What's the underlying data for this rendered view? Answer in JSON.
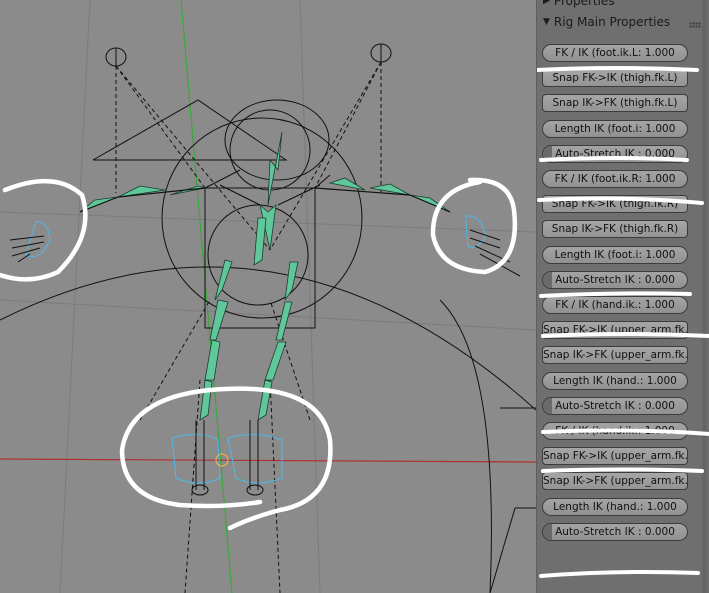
{
  "panel": {
    "properties_header": "Properties",
    "rig_header": "Rig Main Properties",
    "controls": [
      {
        "kind": "slider",
        "label": "FK / IK (foot.ik.L: 1.000",
        "value": 0.0
      },
      {
        "kind": "button",
        "label": "Snap FK->IK (thigh.fk.L)"
      },
      {
        "kind": "button",
        "label": "Snap IK->FK (thigh.fk.L)"
      },
      {
        "kind": "slider",
        "label": "Length IK (foot.i: 1.000",
        "value": 0.0
      },
      {
        "kind": "slider",
        "label": "Auto-Stretch IK : 0.000",
        "value": 0.06
      },
      {
        "kind": "slider",
        "label": "FK / IK (foot.ik.R: 1.000",
        "value": 0.0
      },
      {
        "kind": "button",
        "label": "Snap FK->IK (thigh.fk.R)"
      },
      {
        "kind": "button",
        "label": "Snap IK->FK (thigh.fk.R)"
      },
      {
        "kind": "slider",
        "label": "Length IK (foot.i: 1.000",
        "value": 0.0
      },
      {
        "kind": "slider",
        "label": "Auto-Stretch IK : 0.000",
        "value": 0.06
      },
      {
        "kind": "slider",
        "label": "FK / IK (hand.ik.: 1.000",
        "value": 0.0
      },
      {
        "kind": "button",
        "label": "Snap FK->IK (upper_arm.fk..."
      },
      {
        "kind": "button",
        "label": "Snap IK->FK (upper_arm.fk..."
      },
      {
        "kind": "slider",
        "label": "Length IK (hand.: 1.000",
        "value": 0.0
      },
      {
        "kind": "slider",
        "label": "Auto-Stretch IK : 0.000",
        "value": 0.06
      },
      {
        "kind": "slider",
        "label": "FK / IK (hand.ik.: 1.000",
        "value": 0.0
      },
      {
        "kind": "button",
        "label": "Snap FK->IK (upper_arm.fk..."
      },
      {
        "kind": "button",
        "label": "Snap IK->FK (upper_arm.fk..."
      },
      {
        "kind": "slider",
        "label": "Length IK (hand.: 1.000",
        "value": 0.0
      },
      {
        "kind": "slider",
        "label": "Auto-Stretch IK : 0.000",
        "value": 0.06
      }
    ]
  },
  "colors": {
    "viewport_bg": "#8b8b8b",
    "bone": "#5fc79a",
    "axis_x": "#b03030",
    "axis_y": "#3aa83a",
    "shape_select": "#4fb7e6",
    "annotation": "#ffffff"
  }
}
